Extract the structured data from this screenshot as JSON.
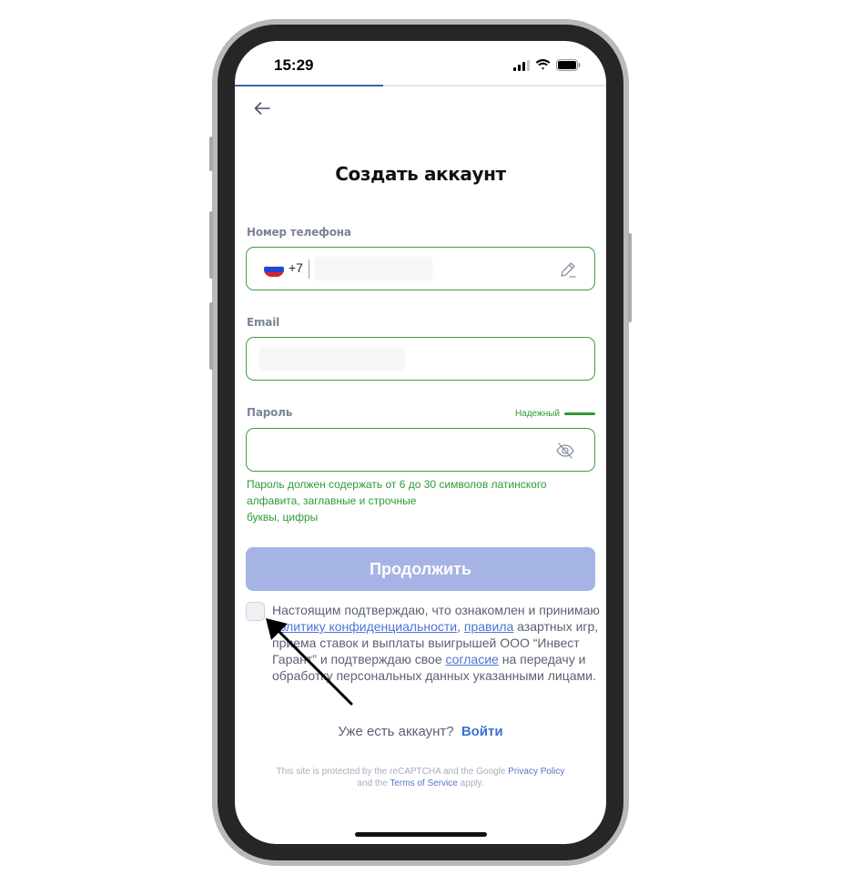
{
  "status_bar": {
    "time": "15:29",
    "icons": [
      "signal-icon",
      "wifi-icon",
      "battery-icon"
    ]
  },
  "progress": {
    "fraction": 0.4,
    "color": "#3f5fb6"
  },
  "header": {
    "back_icon": "arrow-left-icon"
  },
  "title": "Создать аккаунт",
  "phone_field": {
    "label": "Номер телефона",
    "country_flag": "russia-flag-icon",
    "prefix": "+7",
    "edit_icon": "pencil-icon"
  },
  "email_field": {
    "label": "Email"
  },
  "password_field": {
    "label": "Пароль",
    "strength_label": "Надежный",
    "visibility_icon": "eye-off-icon"
  },
  "password_hint": {
    "line1": "Пароль должен содержать от 6 до 30 символов латинского",
    "line2": "алфавита, заглавные и строчные",
    "line3": "буквы, цифры"
  },
  "continue_button": "Продолжить",
  "consent": {
    "text1": "Настоящим подтверждаю, что ознакомлен и принимаю ",
    "link_privacy": "политику конфиденциальности",
    "text2": ", ",
    "link_rules": "правила",
    "text3": " азартных игр, приема ставок и выплаты выигрышей ООО “Инвест Гарант” и подтверждаю свое ",
    "link_consent": "согласие",
    "text4": " на передачу и обработку персональных данных указанными лицами."
  },
  "login_prompt": {
    "text": "Уже есть аккаунт?",
    "link": "Войти"
  },
  "recaptcha": {
    "text1": "This site is protected by the reCAPTCHA and the Google ",
    "link_privacy": "Privacy Policy",
    "text2": "and the ",
    "link_terms": "Terms of Service",
    "text3": " apply."
  },
  "colors": {
    "accent_green": "#3aa043",
    "button_disabled": "#a5b3e5",
    "link_blue": "#4d73d6"
  }
}
